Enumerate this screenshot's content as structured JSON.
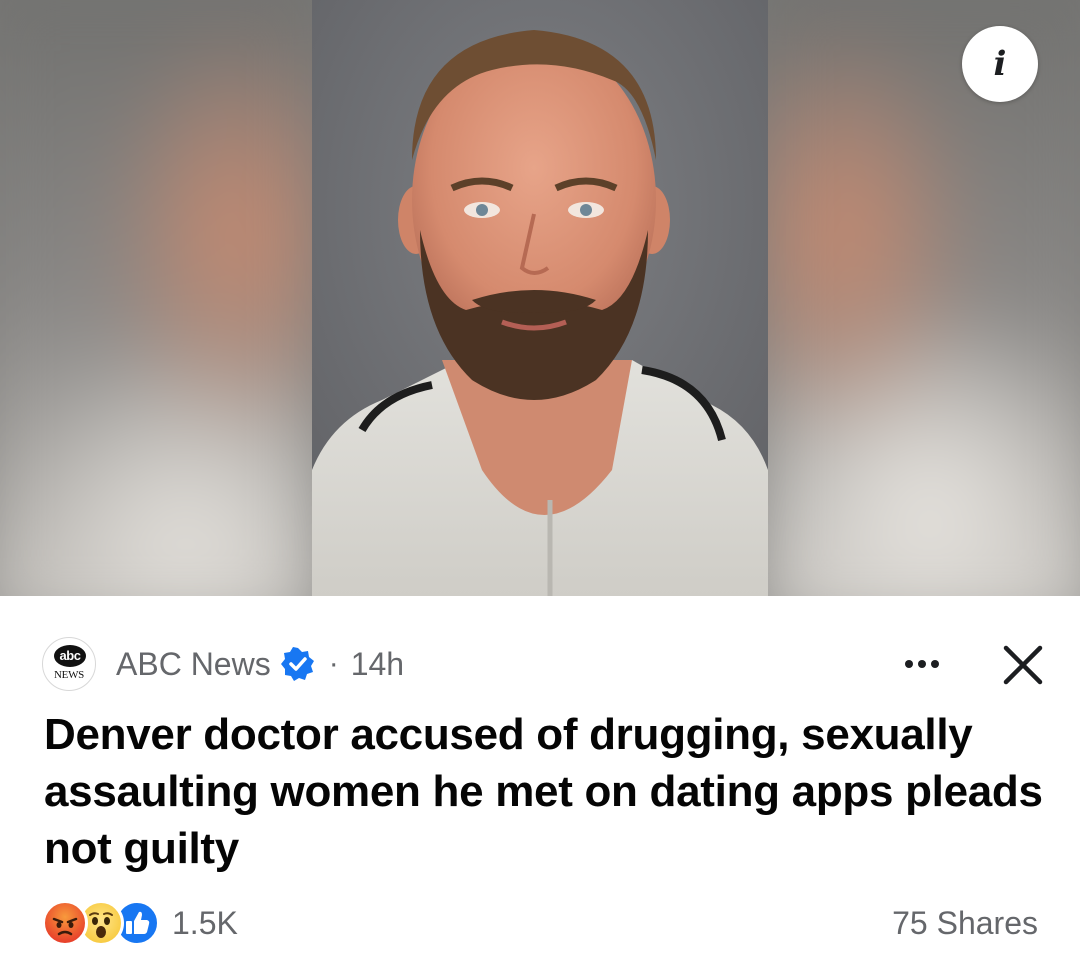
{
  "post": {
    "media": {
      "info_label": "i"
    },
    "source": {
      "logo_text": "abc",
      "logo_subtext": "NEWS",
      "name": "ABC News",
      "verified": true,
      "separator": "·",
      "time": "14h"
    },
    "headline": "Denver doctor accused of drugging, sexually assaulting women he met on dating apps pleads not guilty",
    "footer": {
      "reactions": [
        "angry-reaction-icon",
        "wow-reaction-icon",
        "like-reaction-icon"
      ],
      "reaction_count": "1.5K",
      "shares": "75 Shares"
    }
  },
  "colors": {
    "verified_blue": "#1877f2",
    "secondary_text": "#65676b",
    "primary_text": "#050505"
  }
}
